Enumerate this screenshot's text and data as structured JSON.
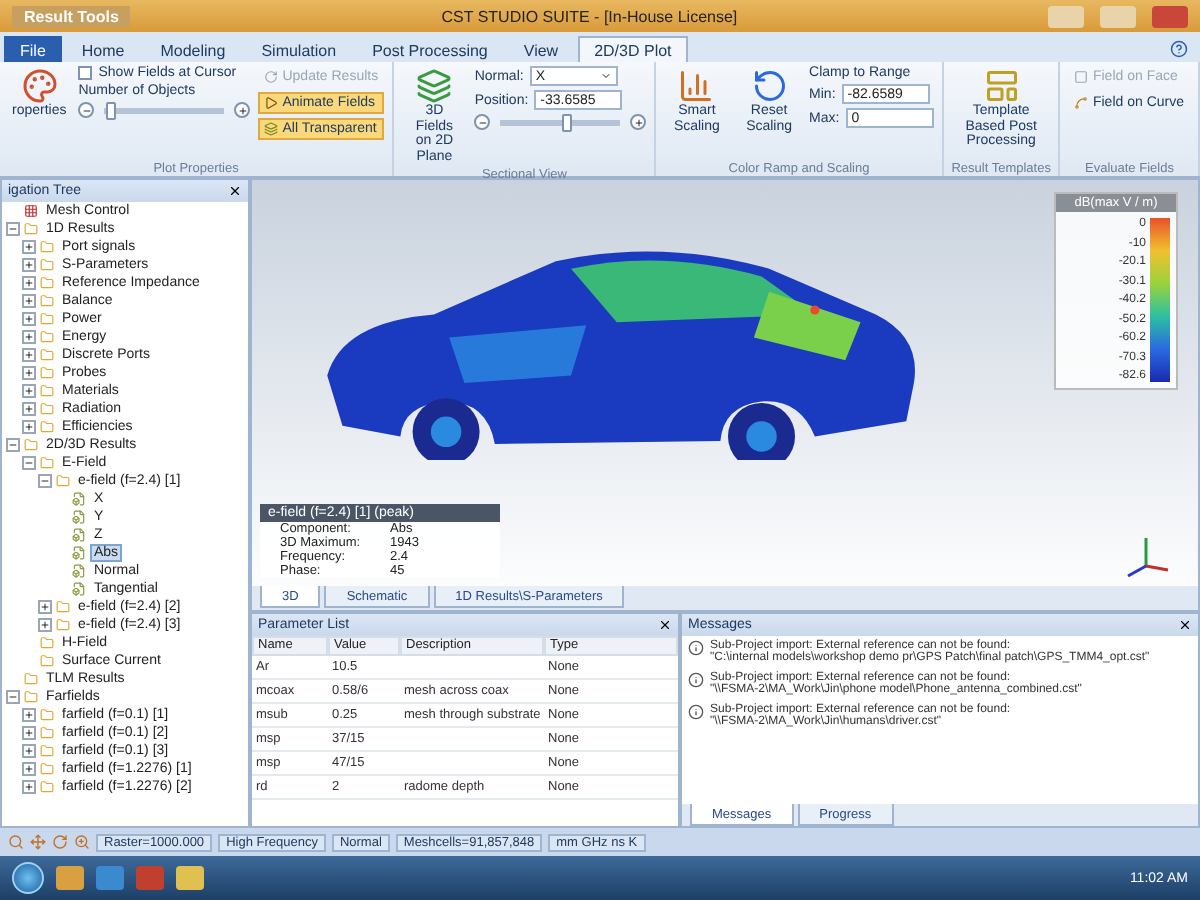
{
  "window": {
    "context_group": "Result Tools",
    "title": "CST STUDIO SUITE - [In-House License]"
  },
  "ribbon_tabs": [
    {
      "label": "File",
      "kind": "file",
      "selected": false
    },
    {
      "label": "Home",
      "kind": "tab",
      "selected": false
    },
    {
      "label": "Modeling",
      "kind": "tab",
      "selected": false
    },
    {
      "label": "Simulation",
      "kind": "tab",
      "selected": false
    },
    {
      "label": "Post Processing",
      "kind": "tab",
      "selected": false
    },
    {
      "label": "View",
      "kind": "tab",
      "selected": false
    },
    {
      "label": "2D/3D Plot",
      "kind": "tab",
      "selected": true
    }
  ],
  "ribbon": {
    "plot_properties": {
      "properties_button": "roperties",
      "show_fields_at_cursor": {
        "label": "Show Fields at Cursor",
        "checked": false
      },
      "number_of_objects": {
        "label": "Number of Objects",
        "level": 0.05
      },
      "update_results": {
        "label": "Update Results",
        "disabled": true
      },
      "animate_fields": {
        "label": "Animate Fields",
        "on": true
      },
      "all_transparent": {
        "label": "All Transparent",
        "on": true
      },
      "group_label": "Plot Properties"
    },
    "sectional_view": {
      "button": "3D Fields on 2D Plane",
      "normal_label": "Normal:",
      "normal_value": "X",
      "position_label": "Position:",
      "position_value": "-33.6585",
      "position_slider": {
        "level": 0.55
      },
      "group_label": "Sectional View"
    },
    "color_ramp": {
      "smart_scaling": "Smart Scaling",
      "reset_scaling": "Reset Scaling",
      "clamp_label": "Clamp to Range",
      "min_label": "Min:",
      "min_value": "-82.6589",
      "max_label": "Max:",
      "max_value": "0",
      "group_label": "Color Ramp and Scaling"
    },
    "result_templates": {
      "button": "Template Based Post Processing",
      "group_label": "Result Templates"
    },
    "evaluate_fields": {
      "field_on_face": {
        "label": "Field on Face",
        "disabled": true
      },
      "field_on_curve": {
        "label": "Field on Curve",
        "disabled": false
      },
      "group_label": "Evaluate Fields"
    }
  },
  "navigation_tree": {
    "title": "igation Tree",
    "items": [
      {
        "label": "Mesh Control",
        "kind": "mesh",
        "selected": false
      },
      {
        "label": "1D Results",
        "kind": "folder",
        "selected": false,
        "expanded": true,
        "children": [
          {
            "label": "Port signals",
            "kind": "folder",
            "selected": false,
            "expanded": false
          },
          {
            "label": "S-Parameters",
            "kind": "folder",
            "selected": false,
            "expanded": false
          },
          {
            "label": "Reference Impedance",
            "kind": "folder",
            "selected": false,
            "expanded": false
          },
          {
            "label": "Balance",
            "kind": "folder",
            "selected": false,
            "expanded": false
          },
          {
            "label": "Power",
            "kind": "folder",
            "selected": false,
            "expanded": false
          },
          {
            "label": "Energy",
            "kind": "folder",
            "selected": false,
            "expanded": false
          },
          {
            "label": "Discrete Ports",
            "kind": "folder",
            "selected": false,
            "expanded": false
          },
          {
            "label": "Probes",
            "kind": "folder",
            "selected": false,
            "expanded": false
          },
          {
            "label": "Materials",
            "kind": "folder",
            "selected": false,
            "expanded": false
          },
          {
            "label": "Radiation",
            "kind": "folder",
            "selected": false,
            "expanded": false
          },
          {
            "label": "Efficiencies",
            "kind": "folder",
            "selected": false,
            "expanded": false
          }
        ]
      },
      {
        "label": "2D/3D Results",
        "kind": "folder",
        "selected": false,
        "expanded": true,
        "children": [
          {
            "label": "E-Field",
            "kind": "folder",
            "selected": false,
            "expanded": true,
            "children": [
              {
                "label": "e-field (f=2.4) [1]",
                "kind": "folder",
                "selected": false,
                "expanded": true,
                "children": [
                  {
                    "label": "X",
                    "kind": "field",
                    "selected": false
                  },
                  {
                    "label": "Y",
                    "kind": "field",
                    "selected": false
                  },
                  {
                    "label": "Z",
                    "kind": "field",
                    "selected": false
                  },
                  {
                    "label": "Abs",
                    "kind": "field",
                    "selected": true
                  },
                  {
                    "label": "Normal",
                    "kind": "field",
                    "selected": false
                  },
                  {
                    "label": "Tangential",
                    "kind": "field",
                    "selected": false
                  }
                ]
              },
              {
                "label": "e-field (f=2.4) [2]",
                "kind": "folder",
                "selected": false,
                "expanded": false
              },
              {
                "label": "e-field (f=2.4) [3]",
                "kind": "folder",
                "selected": false,
                "expanded": false
              }
            ]
          },
          {
            "label": "H-Field",
            "kind": "folder",
            "selected": false
          },
          {
            "label": "Surface Current",
            "kind": "folder",
            "selected": false
          }
        ]
      },
      {
        "label": "TLM Results",
        "kind": "folder",
        "selected": false
      },
      {
        "label": "Farfields",
        "kind": "folder",
        "selected": false,
        "expanded": true,
        "children": [
          {
            "label": "farfield (f=0.1) [1]",
            "kind": "folder",
            "selected": false,
            "expanded": false
          },
          {
            "label": "farfield (f=0.1) [2]",
            "kind": "folder",
            "selected": false,
            "expanded": false
          },
          {
            "label": "farfield (f=0.1) [3]",
            "kind": "folder",
            "selected": false,
            "expanded": false
          },
          {
            "label": "farfield (f=1.2276) [1]",
            "kind": "folder",
            "selected": false,
            "expanded": false
          },
          {
            "label": "farfield (f=1.2276) [2]",
            "kind": "folder",
            "selected": false,
            "expanded": false
          }
        ]
      }
    ]
  },
  "view": {
    "legend": {
      "title": "dB(max V / m)",
      "ticks": [
        "0",
        "-10",
        "-20.1",
        "-30.1",
        "-40.2",
        "-50.2",
        "-60.2",
        "-70.3",
        "-82.6"
      ]
    },
    "info": {
      "title": "e-field (f=2.4) [1] (peak)",
      "rows": [
        {
          "label": "Component:",
          "value": "Abs"
        },
        {
          "label": "3D Maximum:",
          "value": "1943"
        },
        {
          "label": "Frequency:",
          "value": "2.4"
        },
        {
          "label": "Phase:",
          "value": "45"
        }
      ]
    },
    "tabs": [
      {
        "label": "3D",
        "selected": true
      },
      {
        "label": "Schematic",
        "selected": false
      },
      {
        "label": "1D Results\\S-Parameters",
        "selected": false
      }
    ]
  },
  "parameter_list": {
    "title": "Parameter List",
    "columns": [
      "Name",
      "Value",
      "Description",
      "Type"
    ],
    "rows": [
      {
        "name": "Ar",
        "value": "10.5",
        "type": "None"
      },
      {
        "name": "mcoax",
        "value": "0.58/6",
        "description": "mesh across coax",
        "type": "None"
      },
      {
        "name": "msub",
        "value": "0.25",
        "description": "mesh through substrate",
        "type": "None"
      },
      {
        "name": "msp",
        "value": "37/15",
        "type": "None"
      },
      {
        "name": "msp",
        "value": "47/15",
        "type": "None"
      },
      {
        "name": "rd",
        "value": "2",
        "description": "radome depth",
        "type": "None"
      }
    ]
  },
  "messages": {
    "title": "Messages",
    "items": [
      {
        "line_1": "Sub-Project import: External reference can not be found:",
        "line_2": "\"C:\\internal models\\workshop demo pr\\GPS Patch\\final patch\\GPS_TMM4_opt.cst\""
      },
      {
        "line_1": "Sub-Project import: External reference can not be found:",
        "line_2": "\"\\\\FSMA-2\\MA_Work\\Jin\\phone model\\Phone_antenna_combined.cst\""
      },
      {
        "line_1": "Sub-Project import: External reference can not be found:",
        "line_2": "\"\\\\FSMA-2\\MA_Work\\Jin\\humans\\driver.cst\""
      }
    ],
    "tabs": [
      {
        "label": "Messages",
        "selected": true
      },
      {
        "label": "Progress",
        "selected": false
      }
    ]
  },
  "status_bar": {
    "items": [
      "Raster=1000.000",
      "High Frequency",
      "Normal",
      "Meshcells=91,857,848",
      "mm GHz ns K"
    ]
  },
  "taskbar": {
    "time": "11:02 AM"
  }
}
